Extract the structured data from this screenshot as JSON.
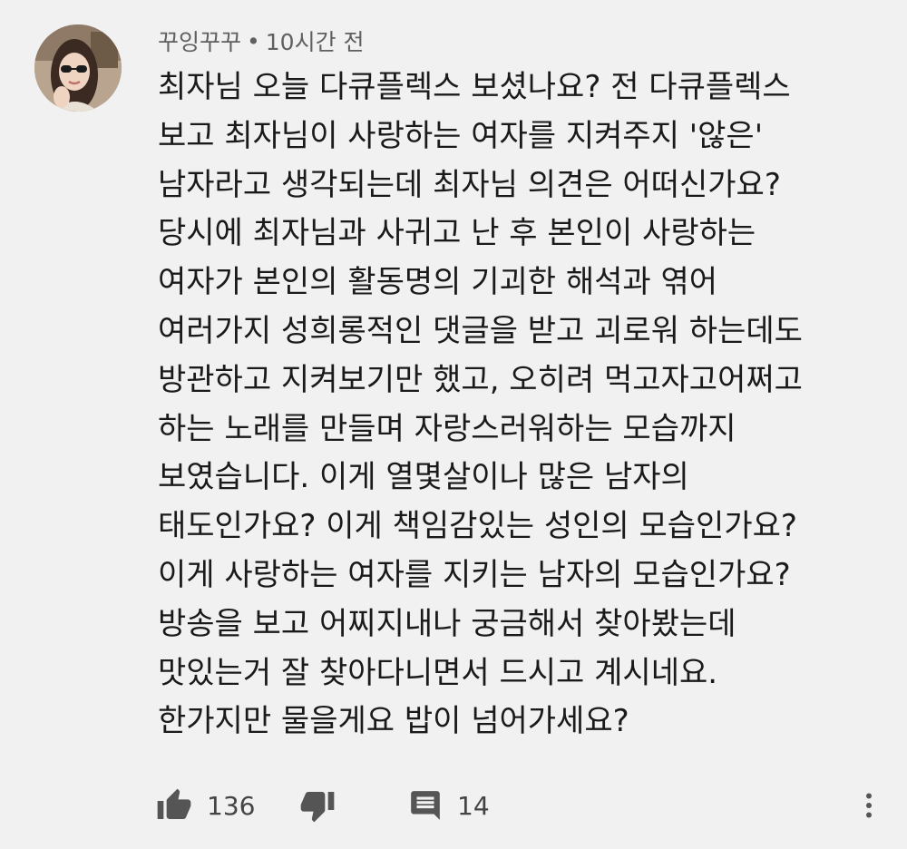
{
  "comment": {
    "author": "꾸잉꾸꾸",
    "separator": "•",
    "time": "10시간 전",
    "text": "최자님 오늘 다큐플렉스 보셨나요? 전 다큐플렉스\n보고 최자님이 사랑하는 여자를 지켜주지 '않은'\n남자라고 생각되는데 최자님 의견은 어떠신가요?\n당시에 최자님과 사귀고 난 후 본인이 사랑하는\n여자가 본인의 활동명의 기괴한 해석과 엮어\n여러가지 성희롱적인 댓글을 받고 괴로워 하는데도\n방관하고 지켜보기만 했고, 오히려 먹고자고어쩌고\n하는 노래를 만들며 자랑스러워하는 모습까지\n보였습니다. 이게 열몇살이나 많은 남자의\n태도인가요? 이게 책임감있는 성인의 모습인가요?\n이게 사랑하는 여자를 지키는 남자의 모습인가요?\n방송을 보고 어찌지내나 궁금해서 찾아봤는데\n맛있는거 잘 찾아다니면서 드시고 계시네요.\n한가지만 물을게요 밥이 넘어가세요?",
    "likes": "136",
    "replies": "14"
  },
  "icons": {
    "avatar": "user-avatar-photo",
    "like": "thumbs-up-icon",
    "dislike": "thumbs-down-icon",
    "reply": "comment-icon",
    "menu": "more-vert-icon"
  },
  "colors": {
    "background": "#f1f1f1",
    "text": "#1a1a1a",
    "meta": "#606060",
    "icon": "#555555"
  }
}
